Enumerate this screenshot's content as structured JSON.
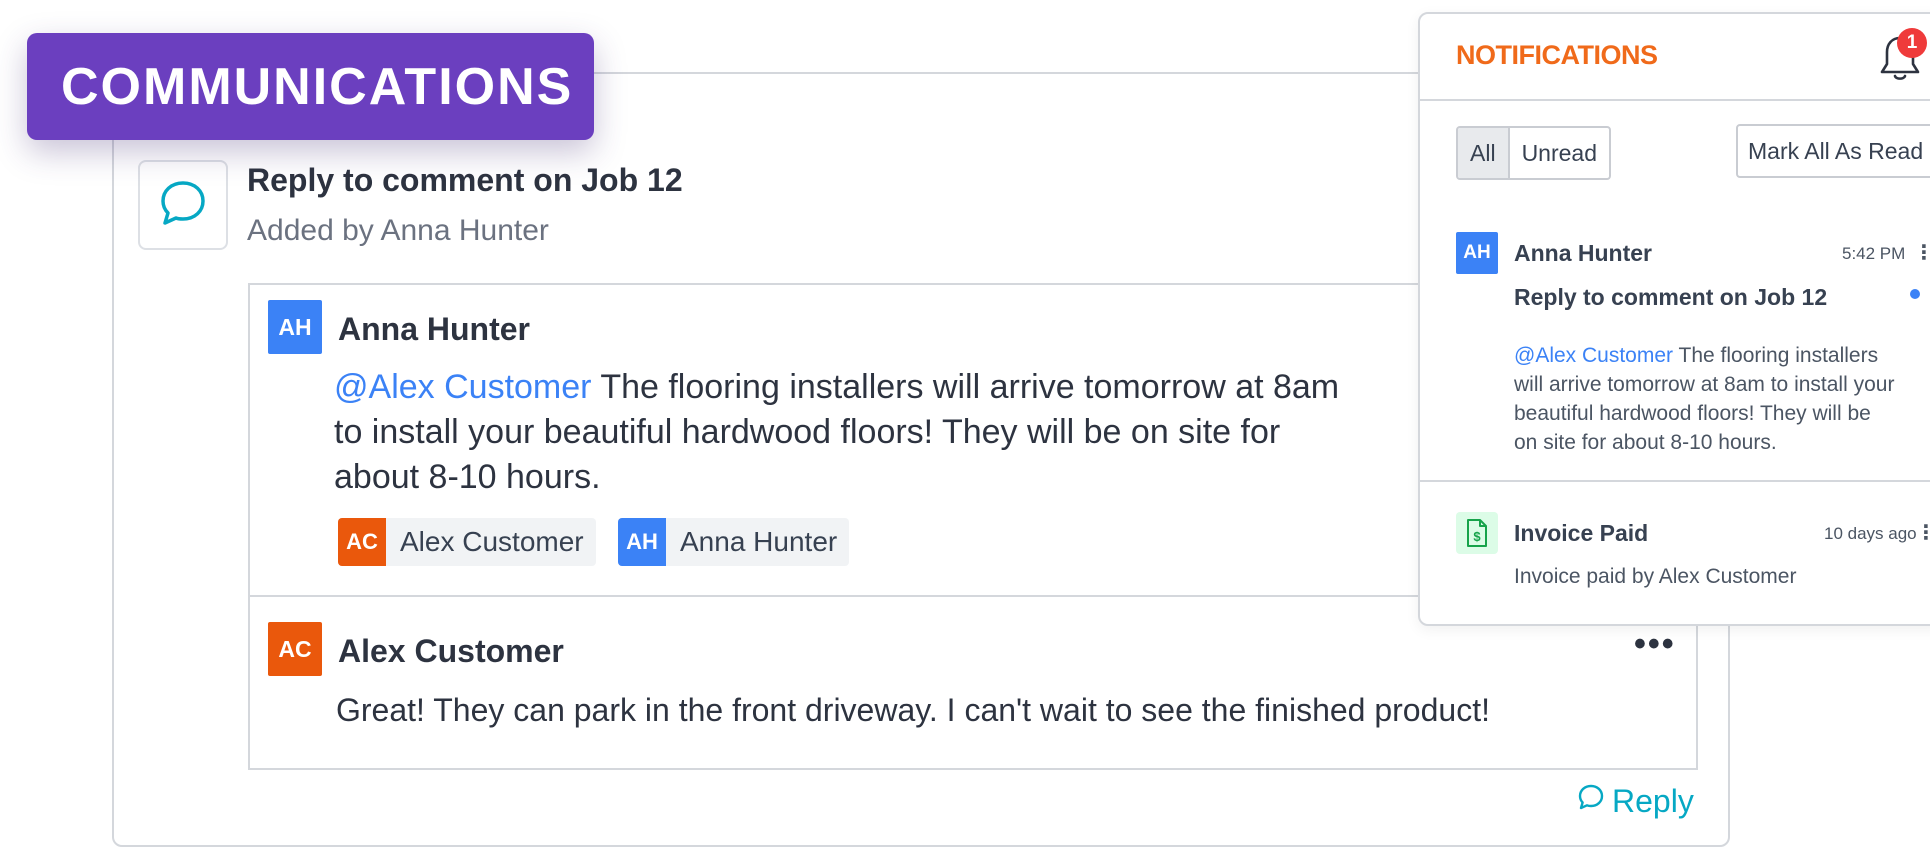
{
  "banner": {
    "label": "COMMUNICATIONS",
    "color": "#6b3fbf"
  },
  "header": {
    "title": "Reply to comment on Job 12",
    "subtitle": "Added by Anna Hunter",
    "icon": "chat-bubble-icon"
  },
  "thread": {
    "messages": [
      {
        "initials": "AH",
        "author": "Anna Hunter",
        "mention": "@Alex Customer",
        "text_line1": "The flooring installers will arrive tomorrow at 8am",
        "text_line2": "to install your beautiful hardwood floors! They will be on site for",
        "text_line3": "about 8-10 hours.",
        "recipients": [
          {
            "initials": "AC",
            "name": "Alex Customer",
            "color": "#ea580c"
          },
          {
            "initials": "AH",
            "name": "Anna Hunter",
            "color": "#3b82f6"
          }
        ]
      },
      {
        "initials": "AC",
        "author": "Alex Customer",
        "text": "Great! They can park in the front driveway. I can't wait to see the finished product!",
        "menu_label": "•••"
      }
    ],
    "reply_label": "Reply"
  },
  "notifications": {
    "title": "NOTIFICATIONS",
    "badge_count": "1",
    "filters": {
      "all": "All",
      "unread": "Unread",
      "active": "All"
    },
    "mark_all_label": "Mark All As Read",
    "items": [
      {
        "initials": "AH",
        "name": "Anna Hunter",
        "time": "5:42 PM",
        "subject": "Reply to comment on Job 12",
        "mention": "@Alex Customer",
        "body_line1": "The flooring installers",
        "body_line2": "will arrive tomorrow at 8am to install your",
        "body_line3": "beautiful hardwood floors! They will be",
        "body_line4": "on site for about 8-10 hours.",
        "unread": true
      },
      {
        "icon": "invoice-dollar-icon",
        "name": "Invoice Paid",
        "time": "10 days ago",
        "body": "Invoice paid by Alex Customer",
        "unread": false
      }
    ],
    "kebab": "⋮"
  },
  "colors": {
    "accent_orange": "#f06a1a",
    "avatar_blue": "#3b82f6",
    "avatar_orange": "#ea580c",
    "reply_teal": "#06a8c4",
    "badge_red": "#ef3b3b"
  }
}
